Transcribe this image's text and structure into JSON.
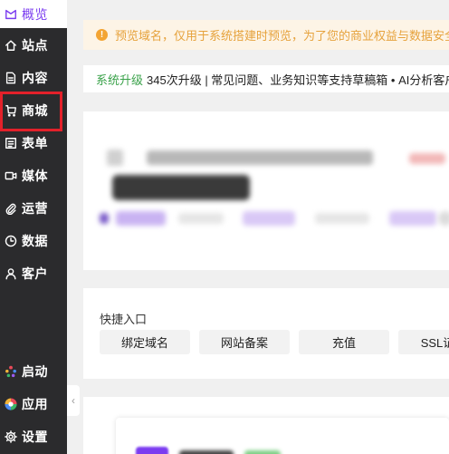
{
  "sidebar": {
    "items": [
      {
        "label": "概览",
        "icon": "overview-icon"
      },
      {
        "label": "站点",
        "icon": "home-icon"
      },
      {
        "label": "内容",
        "icon": "document-icon"
      },
      {
        "label": "商城",
        "icon": "cart-icon"
      },
      {
        "label": "表单",
        "icon": "form-icon"
      },
      {
        "label": "媒体",
        "icon": "media-icon"
      },
      {
        "label": "运营",
        "icon": "paperclip-icon"
      },
      {
        "label": "数据",
        "icon": "clock-icon"
      },
      {
        "label": "客户",
        "icon": "user-icon"
      },
      {
        "label": "启动",
        "icon": "launch-icon"
      },
      {
        "label": "应用",
        "icon": "apps-icon"
      },
      {
        "label": "设置",
        "icon": "gear-icon"
      }
    ],
    "active_index": 0,
    "highlighted_index": 3,
    "collapse_icon": "chevron-left-icon",
    "accent_color": "#7b3cf0",
    "highlight_color": "#e3212a"
  },
  "notice": {
    "text": "预览域名，仅用于系统搭建时预览，为了您的商业权益与数据安全，正式",
    "icon": "warning-icon",
    "color": "#e6a23c"
  },
  "upgrade_bar": {
    "highlight": "系统升级",
    "text": "345次升级 | 常见问题、业务知识等支持草稿箱 • AI分析客户意",
    "highlight_color": "#3aa24a"
  },
  "quick_entry": {
    "title": "快捷入口",
    "buttons": [
      "绑定域名",
      "网站备案",
      "充值",
      "SSL证书"
    ]
  }
}
